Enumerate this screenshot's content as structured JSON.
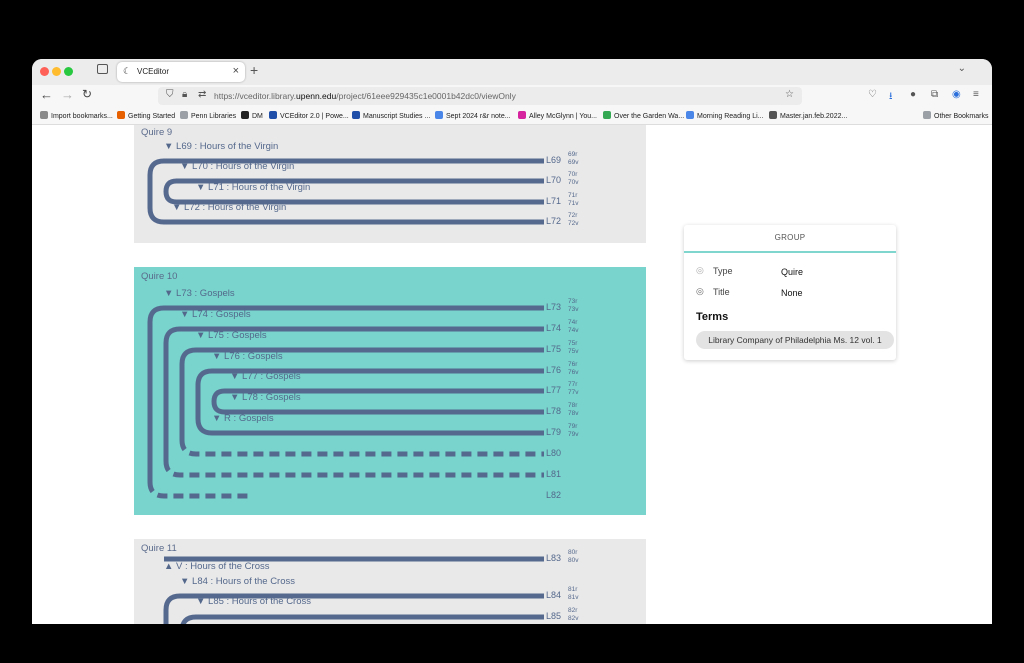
{
  "browser": {
    "tab_title": "VCEditor",
    "url_prefix": "https://vceditor.library.",
    "url_domain": "upenn.edu",
    "url_path": "/project/61eee929435c1e0001b42dc0/viewOnly",
    "bookmarks": [
      {
        "label": "Import bookmarks...",
        "color": "#8a8a8a"
      },
      {
        "label": "Getting Started",
        "color": "#e66000"
      },
      {
        "label": "Penn Libraries",
        "color": "#9aa0a6"
      },
      {
        "label": "DM",
        "color": "#222222"
      },
      {
        "label": "VCEditor 2.0 | Powe...",
        "color": "#1f4fa8"
      },
      {
        "label": "Manuscript Studies ...",
        "color": "#1f4fa8"
      },
      {
        "label": "Sept 2024 r&r note...",
        "color": "#4a86e8"
      },
      {
        "label": "Alley McGlynn | You...",
        "color": "#d6249f"
      },
      {
        "label": "Over the Garden Wa...",
        "color": "#34a853"
      },
      {
        "label": "Morning Reading Li...",
        "color": "#4a86e8"
      },
      {
        "label": "Master.jan.feb.2022...",
        "color": "#555555"
      },
      {
        "label": "Other Bookmarks",
        "color": "#9aa0a6"
      }
    ]
  },
  "quires": [
    {
      "title": "Quire 9",
      "labels": [
        "▼ L69 : Hours of the Virgin",
        "▼ L70 : Hours of the Virgin",
        "▼ L71 : Hours of the Virgin",
        "▼ L72 : Hours of the Virgin"
      ],
      "leaves": [
        {
          "id": "L69",
          "r": "69r",
          "v": "69v"
        },
        {
          "id": "L70",
          "r": "70r",
          "v": "70v"
        },
        {
          "id": "L71",
          "r": "71r",
          "v": "71v"
        },
        {
          "id": "L72",
          "r": "72r",
          "v": "72v"
        }
      ]
    },
    {
      "title": "Quire 10",
      "labels": [
        "▼ L73 : Gospels",
        "▼ L74 : Gospels",
        "▼ L75 : Gospels",
        "▼ L76 : Gospels",
        "▼ L77 : Gospels",
        "▼ L78 : Gospels",
        "▼ R : Gospels"
      ],
      "leaves": [
        {
          "id": "L73",
          "r": "73r",
          "v": "73v"
        },
        {
          "id": "L74",
          "r": "74r",
          "v": "74v"
        },
        {
          "id": "L75",
          "r": "75r",
          "v": "75v"
        },
        {
          "id": "L76",
          "r": "76r",
          "v": "76v"
        },
        {
          "id": "L77",
          "r": "77r",
          "v": "77v"
        },
        {
          "id": "L78",
          "r": "78r",
          "v": "78v"
        },
        {
          "id": "L79",
          "r": "79r",
          "v": "79v"
        },
        {
          "id": "L80",
          "r": "",
          "v": ""
        },
        {
          "id": "L81",
          "r": "",
          "v": ""
        },
        {
          "id": "L82",
          "r": "",
          "v": ""
        }
      ]
    },
    {
      "title": "Quire 11",
      "labels": [
        "▲ V : Hours of the Cross",
        "▼ L84 : Hours of the Cross",
        "▼ L85 : Hours of the Cross"
      ],
      "leaves": [
        {
          "id": "L83",
          "r": "80r",
          "v": "80v"
        },
        {
          "id": "L84",
          "r": "81r",
          "v": "81v"
        },
        {
          "id": "L85",
          "r": "82r",
          "v": "82v"
        }
      ]
    }
  ],
  "panel": {
    "heading": "GROUP",
    "type_label": "Type",
    "type_value": "Quire",
    "title_label": "Title",
    "title_value": "None",
    "terms_heading": "Terms",
    "term": "Library Company of Philadelphia Ms. 12 vol. 1"
  },
  "colors": {
    "leaf_stroke": "#55698f",
    "selected_quire_bg": "#78d4cc",
    "quire_bg": "#e9e9e9"
  }
}
